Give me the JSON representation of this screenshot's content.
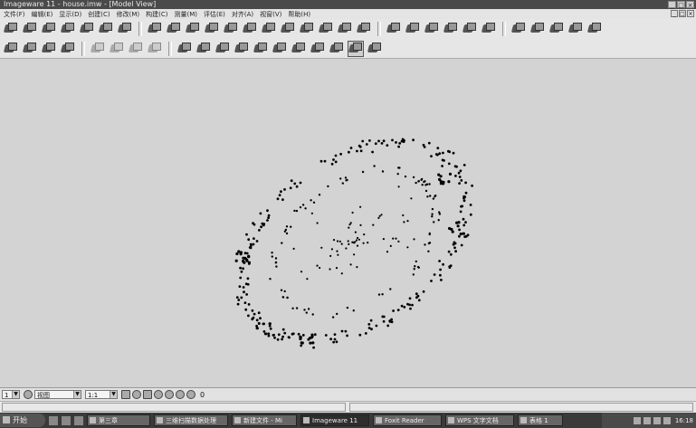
{
  "window": {
    "title": "Imageware 11 - house.imw - [Model View]",
    "controls": [
      "_",
      "□",
      "×"
    ]
  },
  "menu": {
    "items": [
      "文件(F)",
      "编辑(E)",
      "显示(D)",
      "创建(C)",
      "修改(M)",
      "构建(C)",
      "测量(M)",
      "评估(E)",
      "对齐(A)",
      "视窗(V)",
      "帮助(H)"
    ],
    "mdi_controls": [
      "_",
      "□",
      "×"
    ]
  },
  "toolbar1": {
    "icons": [
      "open-icon",
      "save-icon",
      "import-icon",
      "export-icon",
      "copy-icon",
      "layer-icon",
      "surface-icon",
      "shade-icon",
      "point-cloud-icon",
      "curve-icon",
      "section-icon",
      "sample-icon",
      "fit-icon",
      "trim-icon",
      "offset-icon",
      "scan-icon",
      "mesh-icon",
      "triangle-icon",
      "align-icon",
      "register-icon",
      "compare-icon",
      "deviation-icon",
      "measure-icon",
      "plane-icon",
      "cylinder-icon",
      "sphere-icon",
      "cone-icon",
      "extrude-icon",
      "revolve-icon",
      "loft-icon"
    ]
  },
  "toolbar2": {
    "icons": [
      "move-icon",
      "rotate-icon",
      "scale-icon",
      "mirror-icon",
      "undo-icon",
      "redo-icon",
      "arrow-icon",
      "cloud-icon",
      "grid-icon",
      "lightning-icon",
      "spline-icon",
      "angle-icon",
      "vertex-icon",
      "link-icon",
      "zigzag-icon",
      "ruler-icon",
      "cross-icon",
      "no-entry-icon",
      "palette-icon"
    ]
  },
  "statusbar": {
    "combo1": "1",
    "combo2": "视图",
    "combo3": "1:1",
    "counter": "0"
  },
  "taskbar": {
    "start": "开始",
    "tasks": [
      "第三章",
      "三维扫描数据处理",
      "新建文件 - Mi",
      "Imageware 11",
      "Foxit Reader",
      "WPS 文字文档",
      "表格 1"
    ],
    "clock": "16:18"
  },
  "colors": {
    "background": "#d3d3d3",
    "points": "#000000",
    "taskbar": "#3a3a3a"
  }
}
